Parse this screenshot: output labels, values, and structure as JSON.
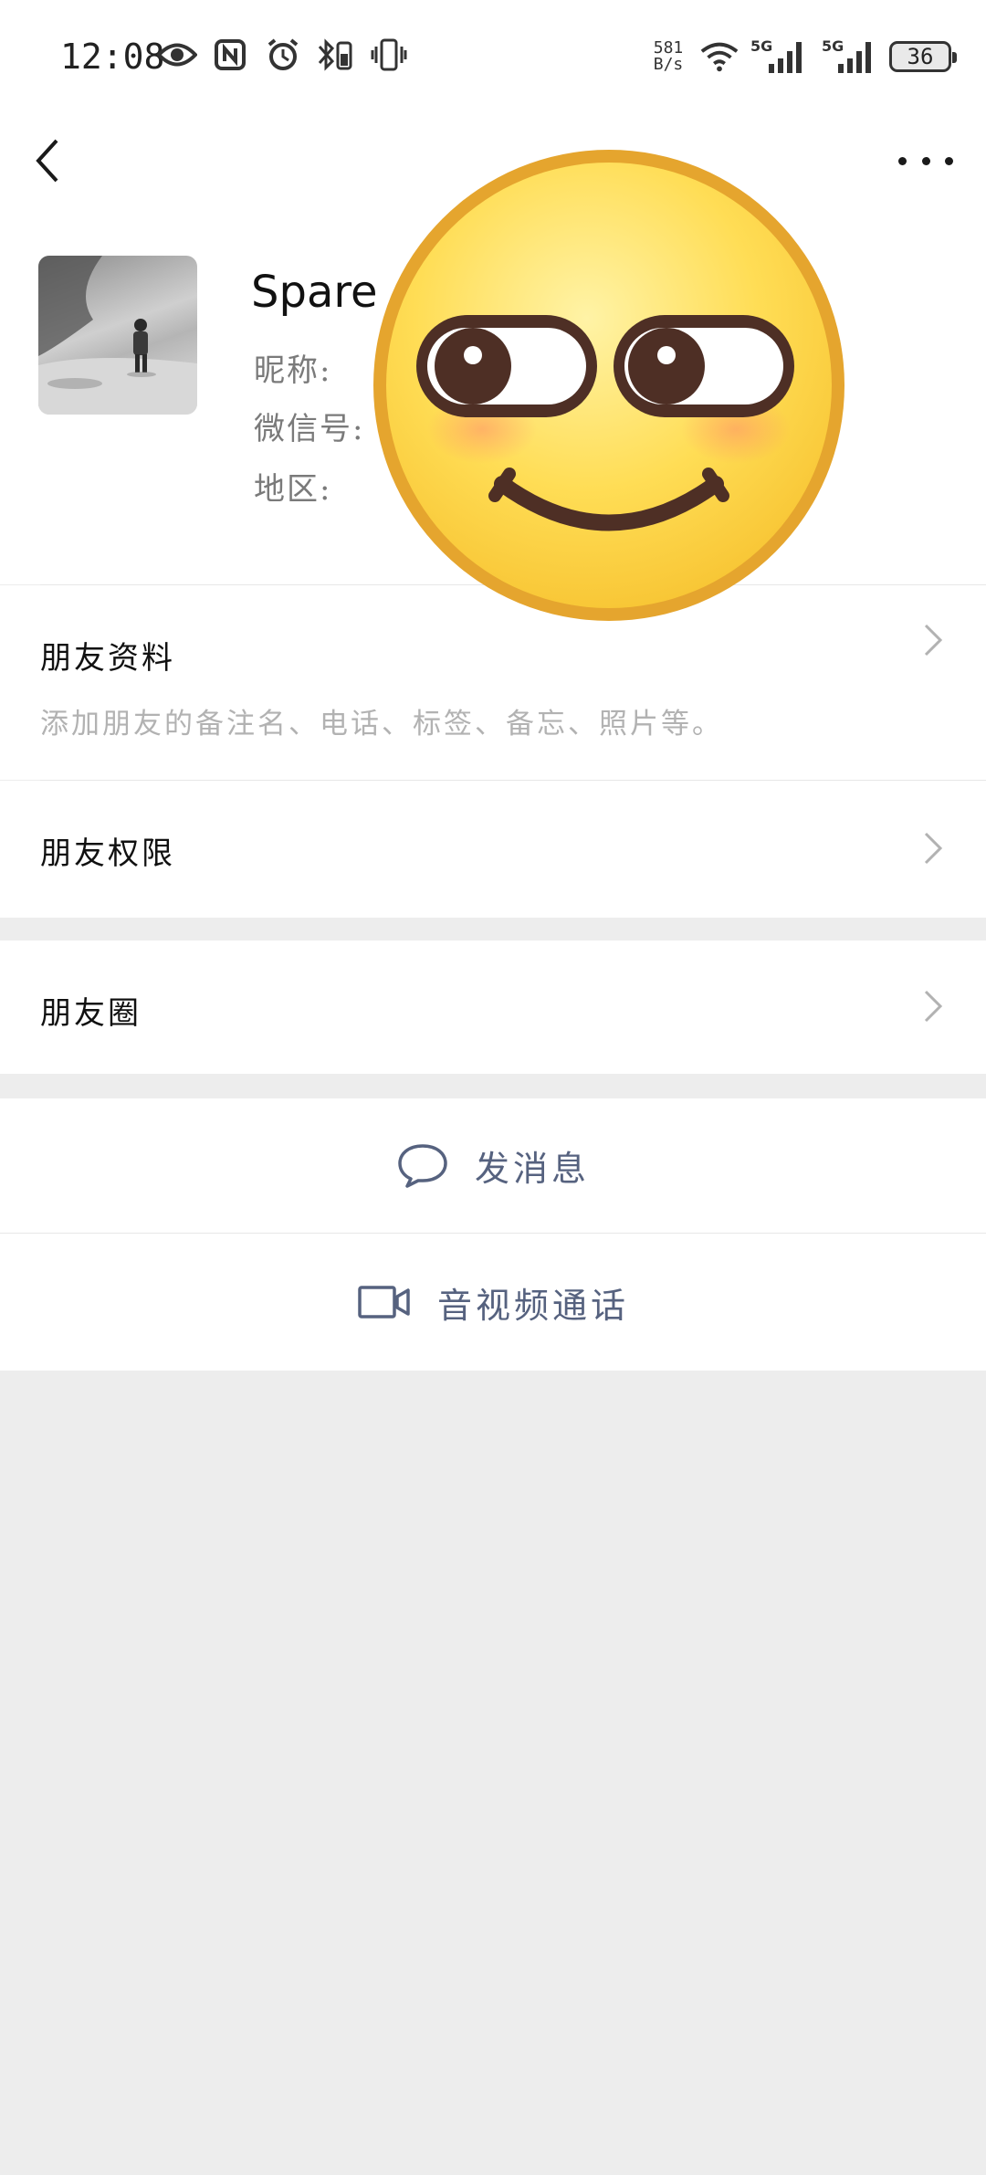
{
  "status_bar": {
    "time": "12:08",
    "net_speed_value": "581",
    "net_speed_unit": "B/s",
    "signal1_label": "5G",
    "signal2_label": "5G",
    "battery": "36"
  },
  "profile": {
    "name": "Spare",
    "nickname_label": "昵称:",
    "wechat_id_label": "微信号:",
    "region_label": "地区:"
  },
  "rows": {
    "friend_info_title": "朋友资料",
    "friend_info_subtitle": "添加朋友的备注名、电话、标签、备忘、照片等。",
    "friend_permissions_title": "朋友权限",
    "moments_title": "朋友圈"
  },
  "actions": {
    "send_message": "发消息",
    "video_call": "音视频通话"
  },
  "colors": {
    "background": "#ededed",
    "card": "#ffffff",
    "action_text": "#56627f",
    "emoji_face": "#ffd94a",
    "emoji_border": "#e5a52e"
  }
}
